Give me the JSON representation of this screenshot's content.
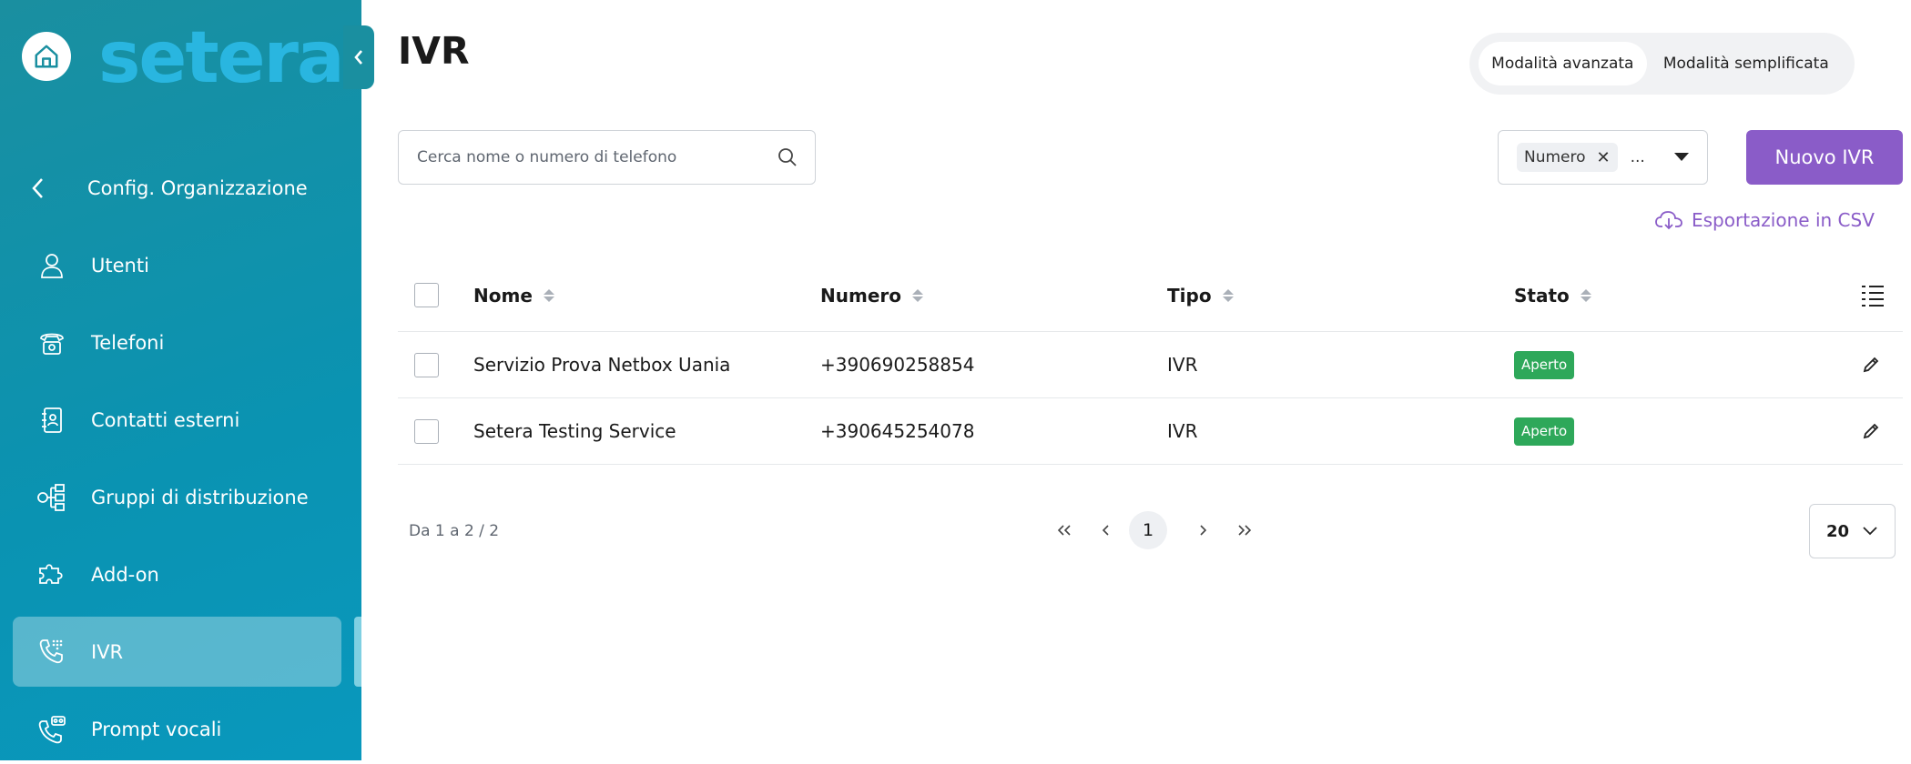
{
  "brand": {
    "logo_text": "setera"
  },
  "sidebar": {
    "back_label": "Config. Organizzazione",
    "items": [
      {
        "label": "Utenti",
        "icon": "user-icon"
      },
      {
        "label": "Telefoni",
        "icon": "desk-phone-icon"
      },
      {
        "label": "Contatti esterni",
        "icon": "contact-book-icon"
      },
      {
        "label": "Gruppi di distribuzione",
        "icon": "hierarchy-icon"
      },
      {
        "label": "Add-on",
        "icon": "puzzle-icon"
      },
      {
        "label": "IVR",
        "icon": "phone-keypad-icon",
        "active": true
      },
      {
        "label": "Prompt vocali",
        "icon": "voicemail-phone-icon"
      }
    ]
  },
  "header": {
    "title": "IVR",
    "mode_advanced": "Modalità avanzata",
    "mode_simple": "Modalità semplificata"
  },
  "search": {
    "placeholder": "Cerca nome o numero di telefono"
  },
  "filter": {
    "chip": "Numero",
    "more": "..."
  },
  "actions": {
    "new_label": "Nuovo IVR",
    "export_label": "Esportazione in CSV"
  },
  "table": {
    "columns": [
      "Nome",
      "Numero",
      "Tipo",
      "Stato"
    ],
    "rows": [
      {
        "nome": "Servizio Prova Netbox Uania",
        "numero": "+390690258854",
        "tipo": "IVR",
        "stato": "Aperto"
      },
      {
        "nome": "Setera Testing Service",
        "numero": "+390645254078",
        "tipo": "IVR",
        "stato": "Aperto"
      }
    ]
  },
  "pagination": {
    "range": "Da 1 a 2 / 2",
    "current_page": "1",
    "per_page": "20"
  },
  "colors": {
    "sidebar": "#0a93b2",
    "accent": "#8a5cc8",
    "status_open": "#2ea85a",
    "logo": "#29b6e0"
  }
}
